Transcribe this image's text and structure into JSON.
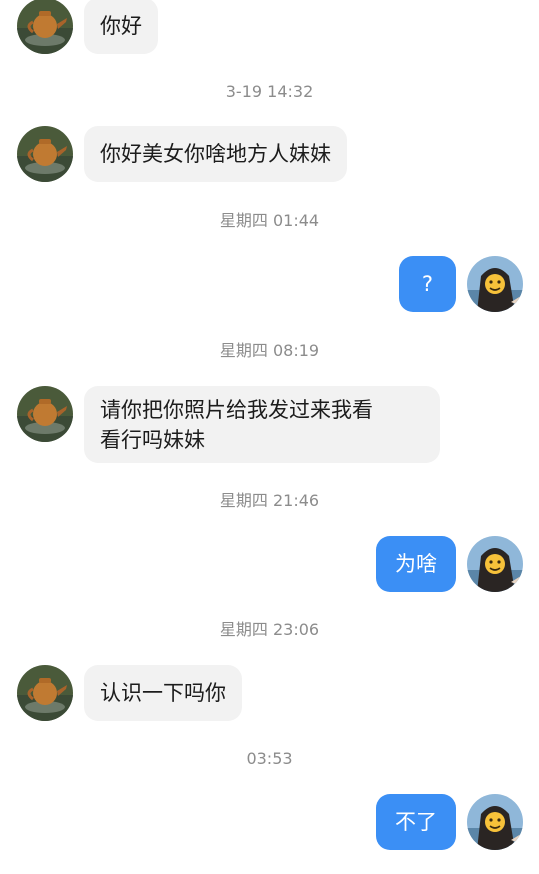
{
  "messages": [
    {
      "side": "in",
      "text": "你好"
    },
    {
      "type": "time",
      "text": "3-19 14:32"
    },
    {
      "side": "in",
      "text": "你好美女你啥地方人妹妹"
    },
    {
      "type": "time",
      "text": "星期四 01:44"
    },
    {
      "side": "out",
      "text": "?"
    },
    {
      "type": "time",
      "text": "星期四 08:19"
    },
    {
      "side": "in",
      "text": "请你把你照片给我发过来我看\n看行吗妹妹"
    },
    {
      "type": "time",
      "text": "星期四 21:46"
    },
    {
      "side": "out",
      "text": "为啥"
    },
    {
      "type": "time",
      "text": "星期四 23:06"
    },
    {
      "side": "in",
      "text": "认识一下吗你"
    },
    {
      "type": "time",
      "text": "03:53"
    },
    {
      "side": "out",
      "text": "不了"
    }
  ],
  "avatars": {
    "contact": "teapot-avatar",
    "self": "girl-sticker-avatar"
  },
  "colors": {
    "incoming_bubble": "#f2f2f2",
    "outgoing_bubble": "#3b8ff5",
    "timestamp": "#8c8c8c"
  }
}
